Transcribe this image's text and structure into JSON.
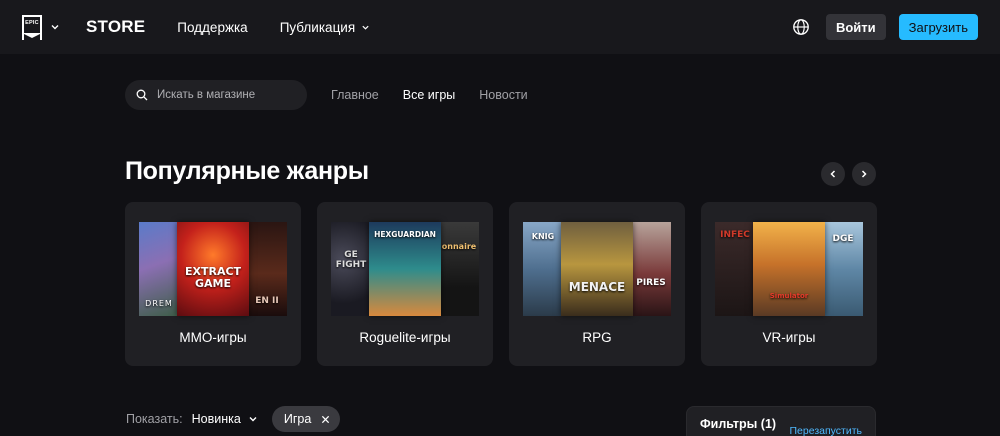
{
  "header": {
    "logo_text": "EPIC GAMES",
    "store_title": "STORE",
    "nav": [
      {
        "label": "Поддержка"
      },
      {
        "label": "Публикация"
      }
    ],
    "login_label": "Войти",
    "download_label": "Загрузить",
    "colors": {
      "bar": "#18181c",
      "accent": "#26bbff"
    }
  },
  "subnav": {
    "search_placeholder": "Искать в магазине",
    "tabs": [
      {
        "label": "Главное",
        "active": false
      },
      {
        "label": "Все игры",
        "active": true
      },
      {
        "label": "Новости",
        "active": false
      }
    ]
  },
  "genres": {
    "title": "Популярные жанры",
    "cards": [
      {
        "label": "MMO-игры",
        "tiles": {
          "left_text": "DREM",
          "center_text": "EXTRACT GAME",
          "right_text": "EN II"
        },
        "colors": [
          "#7b6fb0",
          "#b32218",
          "#3b1d18"
        ]
      },
      {
        "label": "Roguelite-игры",
        "tiles": {
          "left_text": "GE FIGHT",
          "center_text": "HEXGUARDIAN",
          "right_text": "onnaire"
        },
        "colors": [
          "#24242e",
          "#2a7f8a",
          "#1c1c1c"
        ]
      },
      {
        "label": "RPG",
        "tiles": {
          "left_text": "KNIG",
          "center_text": "MENACE",
          "right_text": "PIRES"
        },
        "colors": [
          "#4d6f93",
          "#b88f3a",
          "#5b2a2f"
        ]
      },
      {
        "label": "VR-игры",
        "tiles": {
          "left_text": "INFEC",
          "center_text": "Simulator",
          "right_text": "DGE"
        },
        "colors": [
          "#2a2323",
          "#c37a2a",
          "#5f87a6"
        ]
      }
    ]
  },
  "browse": {
    "show_label": "Показать:",
    "sort_value": "Новинка",
    "chip_label": "Игра",
    "filters_title": "Фильтры (1)",
    "filters_reset": "Перезапустить"
  }
}
